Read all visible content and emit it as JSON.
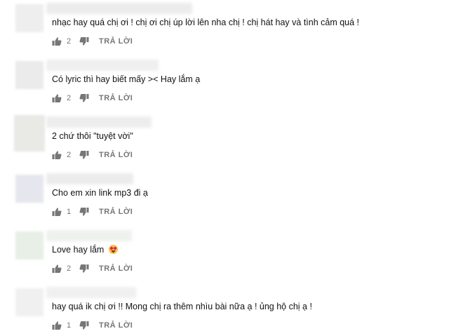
{
  "reply_label": "TRẢ LỜI",
  "colors": {
    "meta_gray": "#767676",
    "text": "#111111"
  },
  "comments": [
    {
      "text": "nhạc hay quá chị ơi ! chị ơi chị úp lời lên nha chị ! chị hát hay và tình cảm quá !",
      "likes": "2"
    },
    {
      "text": "Có lyric thì hay biết mấy >< Hay lắm ạ",
      "likes": "2"
    },
    {
      "text": "2 chứ thôi \"tuyệt vời\"",
      "likes": "2"
    },
    {
      "text": "Cho em xin link mp3 đi ạ",
      "likes": "1"
    },
    {
      "text": "Love hay lắm",
      "likes": "2",
      "emoji": "heart-eyes-emoji"
    },
    {
      "text": "hay quá ik chị ơi !! Mong chị ra thêm nhìu bài nữa ạ ! ủng hộ chị ạ !",
      "likes": "1"
    }
  ]
}
